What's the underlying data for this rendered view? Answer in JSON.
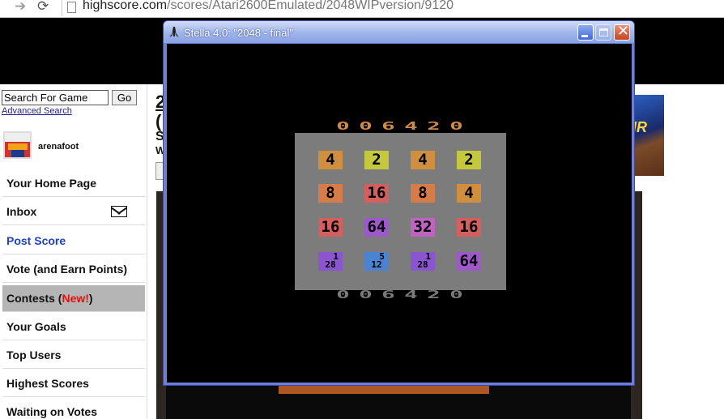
{
  "browser": {
    "url_host": "highscore.com",
    "url_path": "/scores/Atari2600Emulated/2048WIPversion/9120"
  },
  "sidebar": {
    "search_placeholder": "Search For Game",
    "go_label": "Go",
    "advanced_search": "Advanced Search",
    "username": "arenafoot",
    "nav": [
      {
        "label": "Your Home Page"
      },
      {
        "label": "Inbox"
      },
      {
        "label": "Post Score"
      },
      {
        "label": "Vote (and Earn Points)"
      },
      {
        "label": "Contests (",
        "badge": "New!",
        "suffix": ")"
      },
      {
        "label": "Your Goals"
      },
      {
        "label": "Top Users"
      },
      {
        "label": "Highest Scores"
      },
      {
        "label": "Waiting on Votes"
      }
    ]
  },
  "page_peek": {
    "line1": "2",
    "line2": "(",
    "line3": "S",
    "line4": "W",
    "banner_text": "IR"
  },
  "emulator": {
    "title": "Stella 4.0: \"2048 - final\"",
    "close_glyph": "✕",
    "score": "006420",
    "score_digits": [
      "0",
      "0",
      "6",
      "4",
      "2",
      "0"
    ],
    "tiles": [
      [
        {
          "v": "4",
          "color": "#cf8f3f"
        },
        {
          "v": "2",
          "color": "#c3c83d"
        },
        {
          "v": "4",
          "color": "#cf8f3f"
        },
        {
          "v": "2",
          "color": "#c3c83d"
        }
      ],
      [
        {
          "v": "8",
          "color": "#d67c48"
        },
        {
          "v": "16",
          "color": "#d45f5f"
        },
        {
          "v": "8",
          "color": "#d67c48"
        },
        {
          "v": "4",
          "color": "#cf8f3f"
        }
      ],
      [
        {
          "v": "16",
          "color": "#d45f5f"
        },
        {
          "v": "64",
          "color": "#9d58c9"
        },
        {
          "v": "32",
          "color": "#bf63c1"
        },
        {
          "v": "16",
          "color": "#d45f5f"
        }
      ],
      [
        {
          "v": "128",
          "color": "#8b55d0",
          "top": "1",
          "bottom": "28"
        },
        {
          "v": "512",
          "color": "#4b83d1",
          "top": "5",
          "bottom": "12"
        },
        {
          "v": "128",
          "color": "#8b55d0",
          "top": "1",
          "bottom": "28"
        },
        {
          "v": "64",
          "color": "#9d58c9"
        }
      ]
    ]
  }
}
